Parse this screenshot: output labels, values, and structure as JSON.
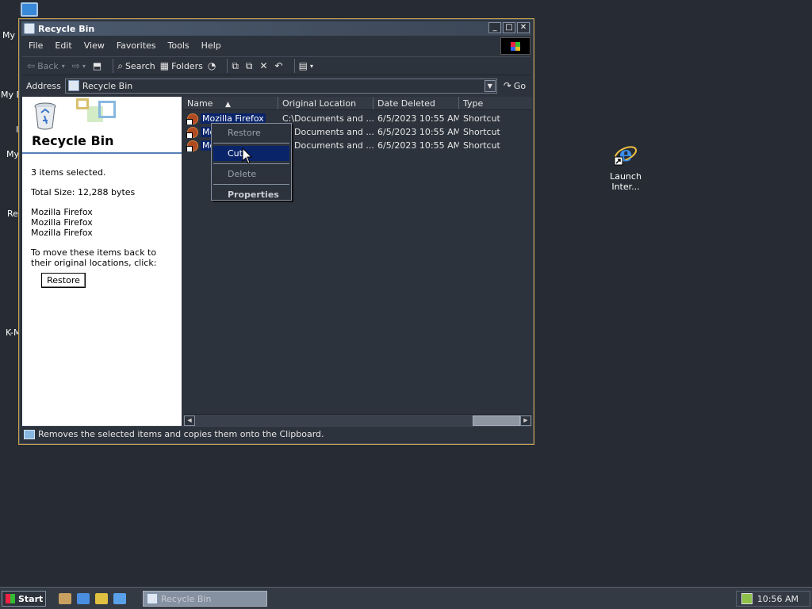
{
  "desktop": {
    "left_labels": [
      "My",
      "My D",
      "I",
      "My",
      "Re",
      "K-M"
    ],
    "ie_shortcut_label": "Launch Inter..."
  },
  "window": {
    "title": "Recycle Bin",
    "buttons": {
      "minimize": "_",
      "maximize": "□",
      "close": "✕"
    }
  },
  "menu": [
    "File",
    "Edit",
    "View",
    "Favorites",
    "Tools",
    "Help"
  ],
  "toolbar": {
    "back": "Back",
    "forward": "",
    "search": "Search",
    "folders": "Folders"
  },
  "address": {
    "label": "Address",
    "value": "Recycle Bin",
    "go": "Go"
  },
  "left_pane": {
    "title": "Recycle Bin",
    "selected": "3 items selected.",
    "total_size": "Total Size: 12,288 bytes",
    "items": [
      "Mozilla Firefox",
      "Mozilla Firefox",
      "Mozilla Firefox"
    ],
    "restore_text": "To move these items back to their original locations, click:",
    "restore_button": "Restore"
  },
  "columns": [
    "Name",
    "Original Location",
    "Date Deleted",
    "Type"
  ],
  "rows": [
    {
      "name": "Mozilla Firefox",
      "location": "C:\\Documents and ...",
      "date": "6/5/2023 10:55 AM",
      "type": "Shortcut"
    },
    {
      "name": "Moz",
      "location": "Documents and ...",
      "date": "6/5/2023 10:55 AM",
      "type": "Shortcut"
    },
    {
      "name": "Moz",
      "location": "Documents and ...",
      "date": "6/5/2023 10:55 AM",
      "type": "Shortcut"
    }
  ],
  "context_menu": {
    "restore": "Restore",
    "cut": "Cut",
    "delete": "Delete",
    "properties": "Properties"
  },
  "status": "Removes the selected items and copies them onto the Clipboard.",
  "taskbar": {
    "start": "Start",
    "task": "Recycle Bin",
    "clock": "10:56 AM"
  }
}
